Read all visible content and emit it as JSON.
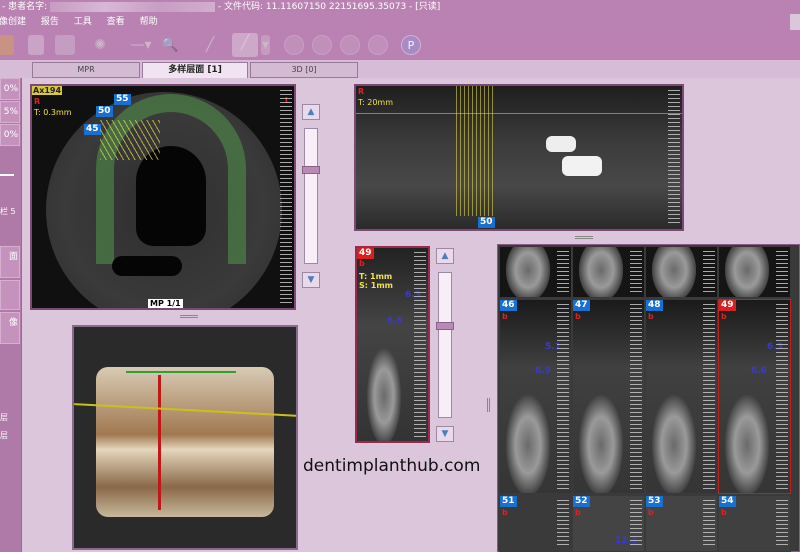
{
  "title": {
    "prefix": "- 患者名字:",
    "file_code": "- 文件代码: 11.11607150 22151695.35073",
    "mode": "- [只读]"
  },
  "menu": [
    "图像创建",
    "报告",
    "工具",
    "查看",
    "帮助"
  ],
  "toolbar": {
    "icons": [
      "folder-icon",
      "document-icon",
      "print-icon",
      "brightness-icon",
      "line-tool-icon",
      "zoom-icon",
      "pen-icon",
      "curve-tool-icon",
      "first-frame-icon",
      "prev-frame-icon",
      "play-icon",
      "last-frame-icon",
      "help-icon"
    ]
  },
  "tabs": [
    {
      "label": "MPR",
      "active": false
    },
    {
      "label": "多样层面 [1]",
      "active": true
    },
    {
      "label": "3D [0]",
      "active": false
    }
  ],
  "sidebar": {
    "buttons": [
      "0%",
      "5%",
      "0%"
    ],
    "label_width": "栏 5",
    "buttons2": [
      "面",
      "",
      "像"
    ],
    "labels": [
      "层",
      "层"
    ]
  },
  "axial": {
    "title": "Ax194",
    "orientation_left": "R",
    "orientation_right": "L",
    "thickness": "T: 0.3mm",
    "markers": [
      "55",
      "50",
      "45"
    ],
    "footer": "MP 1/1",
    "ruler": [
      "80",
      "70",
      "60",
      "50",
      "40",
      "30",
      "20",
      "10"
    ]
  },
  "panoramic": {
    "orientation": "R",
    "thickness": "T: 20mm",
    "marker": "50",
    "ruler": [
      "50",
      "40",
      "30",
      "20",
      "10"
    ]
  },
  "cross_single": {
    "number": "49",
    "orientation": "b",
    "thickness": "T: 1mm",
    "spacing": "S: 1mm",
    "meas1": "6.3",
    "meas2": "6.6"
  },
  "grid": {
    "top_row_ruler": [
      "20",
      "10"
    ],
    "middle": [
      {
        "number": "46",
        "meas": [
          "5.1",
          "6.9"
        ],
        "selected": false
      },
      {
        "number": "47",
        "meas": [],
        "selected": false
      },
      {
        "number": "48",
        "meas": [],
        "selected": false
      },
      {
        "number": "49",
        "meas": [
          "6.3",
          "6.6"
        ],
        "selected": true
      }
    ],
    "bottom": [
      {
        "number": "51",
        "meas": []
      },
      {
        "number": "52",
        "meas": [
          "12.3"
        ]
      },
      {
        "number": "53",
        "meas": []
      },
      {
        "number": "54",
        "meas": []
      }
    ],
    "ruler": [
      "70",
      "60",
      "50",
      "40",
      "30",
      "20",
      "10"
    ],
    "orientation_b": "b",
    "orientation_l": "l"
  },
  "watermark": "dentimplanthub.com",
  "colors": {
    "chrome": "#b982b2",
    "background": "#dcc6dc",
    "selected": "#d82020",
    "marker": "#1a70d0"
  }
}
